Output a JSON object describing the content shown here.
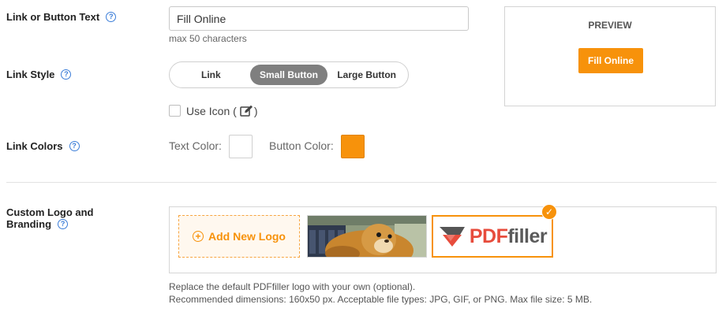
{
  "link_text": {
    "label": "Link or Button Text",
    "value": "Fill Online",
    "hint": "max 50 characters"
  },
  "preview": {
    "title": "PREVIEW",
    "button_label": "Fill Online"
  },
  "link_style": {
    "label": "Link Style",
    "options": [
      "Link",
      "Small Button",
      "Large Button"
    ],
    "selected": "Small Button"
  },
  "use_icon": {
    "label": "Use Icon (",
    "label_close": ")",
    "checked": false,
    "icon": "edit-icon"
  },
  "link_colors": {
    "label": "Link Colors",
    "text_color_label": "Text Color:",
    "text_color": "#ffffff",
    "button_color_label": "Button Color:",
    "button_color": "#f7920b"
  },
  "branding": {
    "label_line1": "Custom Logo and",
    "label_line2": "Branding",
    "add_logo_label": "Add New Logo",
    "selected_logo_text_a": "PDF",
    "selected_logo_text_b": "filler",
    "note_line1": "Replace the default PDFfiller logo with your own (optional).",
    "note_line2": "Recommended dimensions: 160x50 px. Acceptable file types: JPG, GIF, or PNG. Max file size: 5 MB."
  },
  "colors": {
    "accent": "#f7920b",
    "help_icon": "#3b7dd8",
    "active_segment": "#7f7f7f"
  }
}
